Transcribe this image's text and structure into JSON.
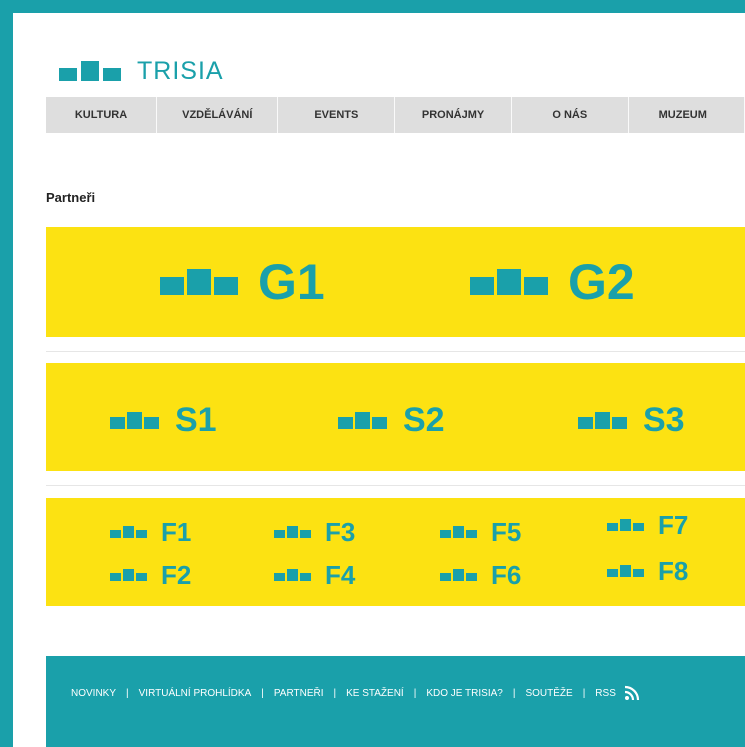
{
  "colors": {
    "accent": "#1aa0aa",
    "partner_band": "#fce212",
    "nav_bg": "#dedede"
  },
  "logo": {
    "text": "TRISIA"
  },
  "nav": {
    "items": [
      "KULTURA",
      "VZDĚLÁVÁNÍ",
      "EVENTS",
      "PRONÁJMY",
      "O NÁS",
      "MUZEUM"
    ]
  },
  "section_title": "Partneři",
  "partners": {
    "gold": [
      "G1",
      "G2"
    ],
    "silver": [
      "S1",
      "S2",
      "S3"
    ],
    "friends": [
      "F1",
      "F2",
      "F3",
      "F4",
      "F5",
      "F6",
      "F7",
      "F8"
    ]
  },
  "footer": {
    "links": [
      "NOVINKY",
      "VIRTUÁLNÍ PROHLÍDKA",
      "PARTNEŘI",
      "KE STAŽENÍ",
      "KDO JE TRISIA?",
      "SOUTĚŽE",
      "RSS"
    ],
    "separator": "|",
    "rss_icon": "rss-icon"
  }
}
